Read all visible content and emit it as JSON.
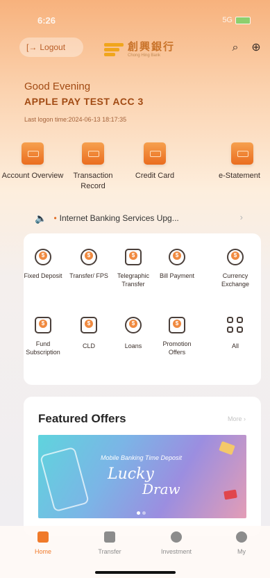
{
  "status_bar": {
    "time": "6:26",
    "signal": "5G"
  },
  "header": {
    "logout_label": "Logout",
    "logo_cn": "創興銀行",
    "logo_en": "Chong Hing Bank"
  },
  "profile": {
    "greeting": "Good Evening",
    "account_name": "APPLE PAY TEST ACC 3",
    "last_logon": "Last logon time:2024-06-13 18:17:35"
  },
  "quick_actions": [
    {
      "label": "Account Overview"
    },
    {
      "label": "Transaction Record"
    },
    {
      "label": "Credit Card"
    },
    {
      "label": "e-Statement"
    }
  ],
  "notice": {
    "text": "Internet Banking Services Upg..."
  },
  "services": [
    {
      "label": "Fixed Deposit"
    },
    {
      "label": "Transfer/ FPS"
    },
    {
      "label": "Telegraphic Transfer"
    },
    {
      "label": "Bill Payment"
    },
    {
      "label": "Currency Exchange"
    },
    {
      "label": "Fund Subscription"
    },
    {
      "label": "CLD"
    },
    {
      "label": "Loans"
    },
    {
      "label": "Promotion Offers"
    },
    {
      "label": "All"
    }
  ],
  "featured": {
    "title": "Featured Offers",
    "more_label": "More",
    "banner_headline": "Mobile Banking Time Deposit",
    "banner_title_1": "Lucky",
    "banner_title_2": "Draw"
  },
  "tabbar": [
    {
      "label": "Home",
      "active": true
    },
    {
      "label": "Transfer",
      "active": false
    },
    {
      "label": "Investment",
      "active": false
    },
    {
      "label": "My",
      "active": false
    }
  ],
  "colors": {
    "accent": "#f07a2a",
    "brand_text": "#a14a13"
  }
}
